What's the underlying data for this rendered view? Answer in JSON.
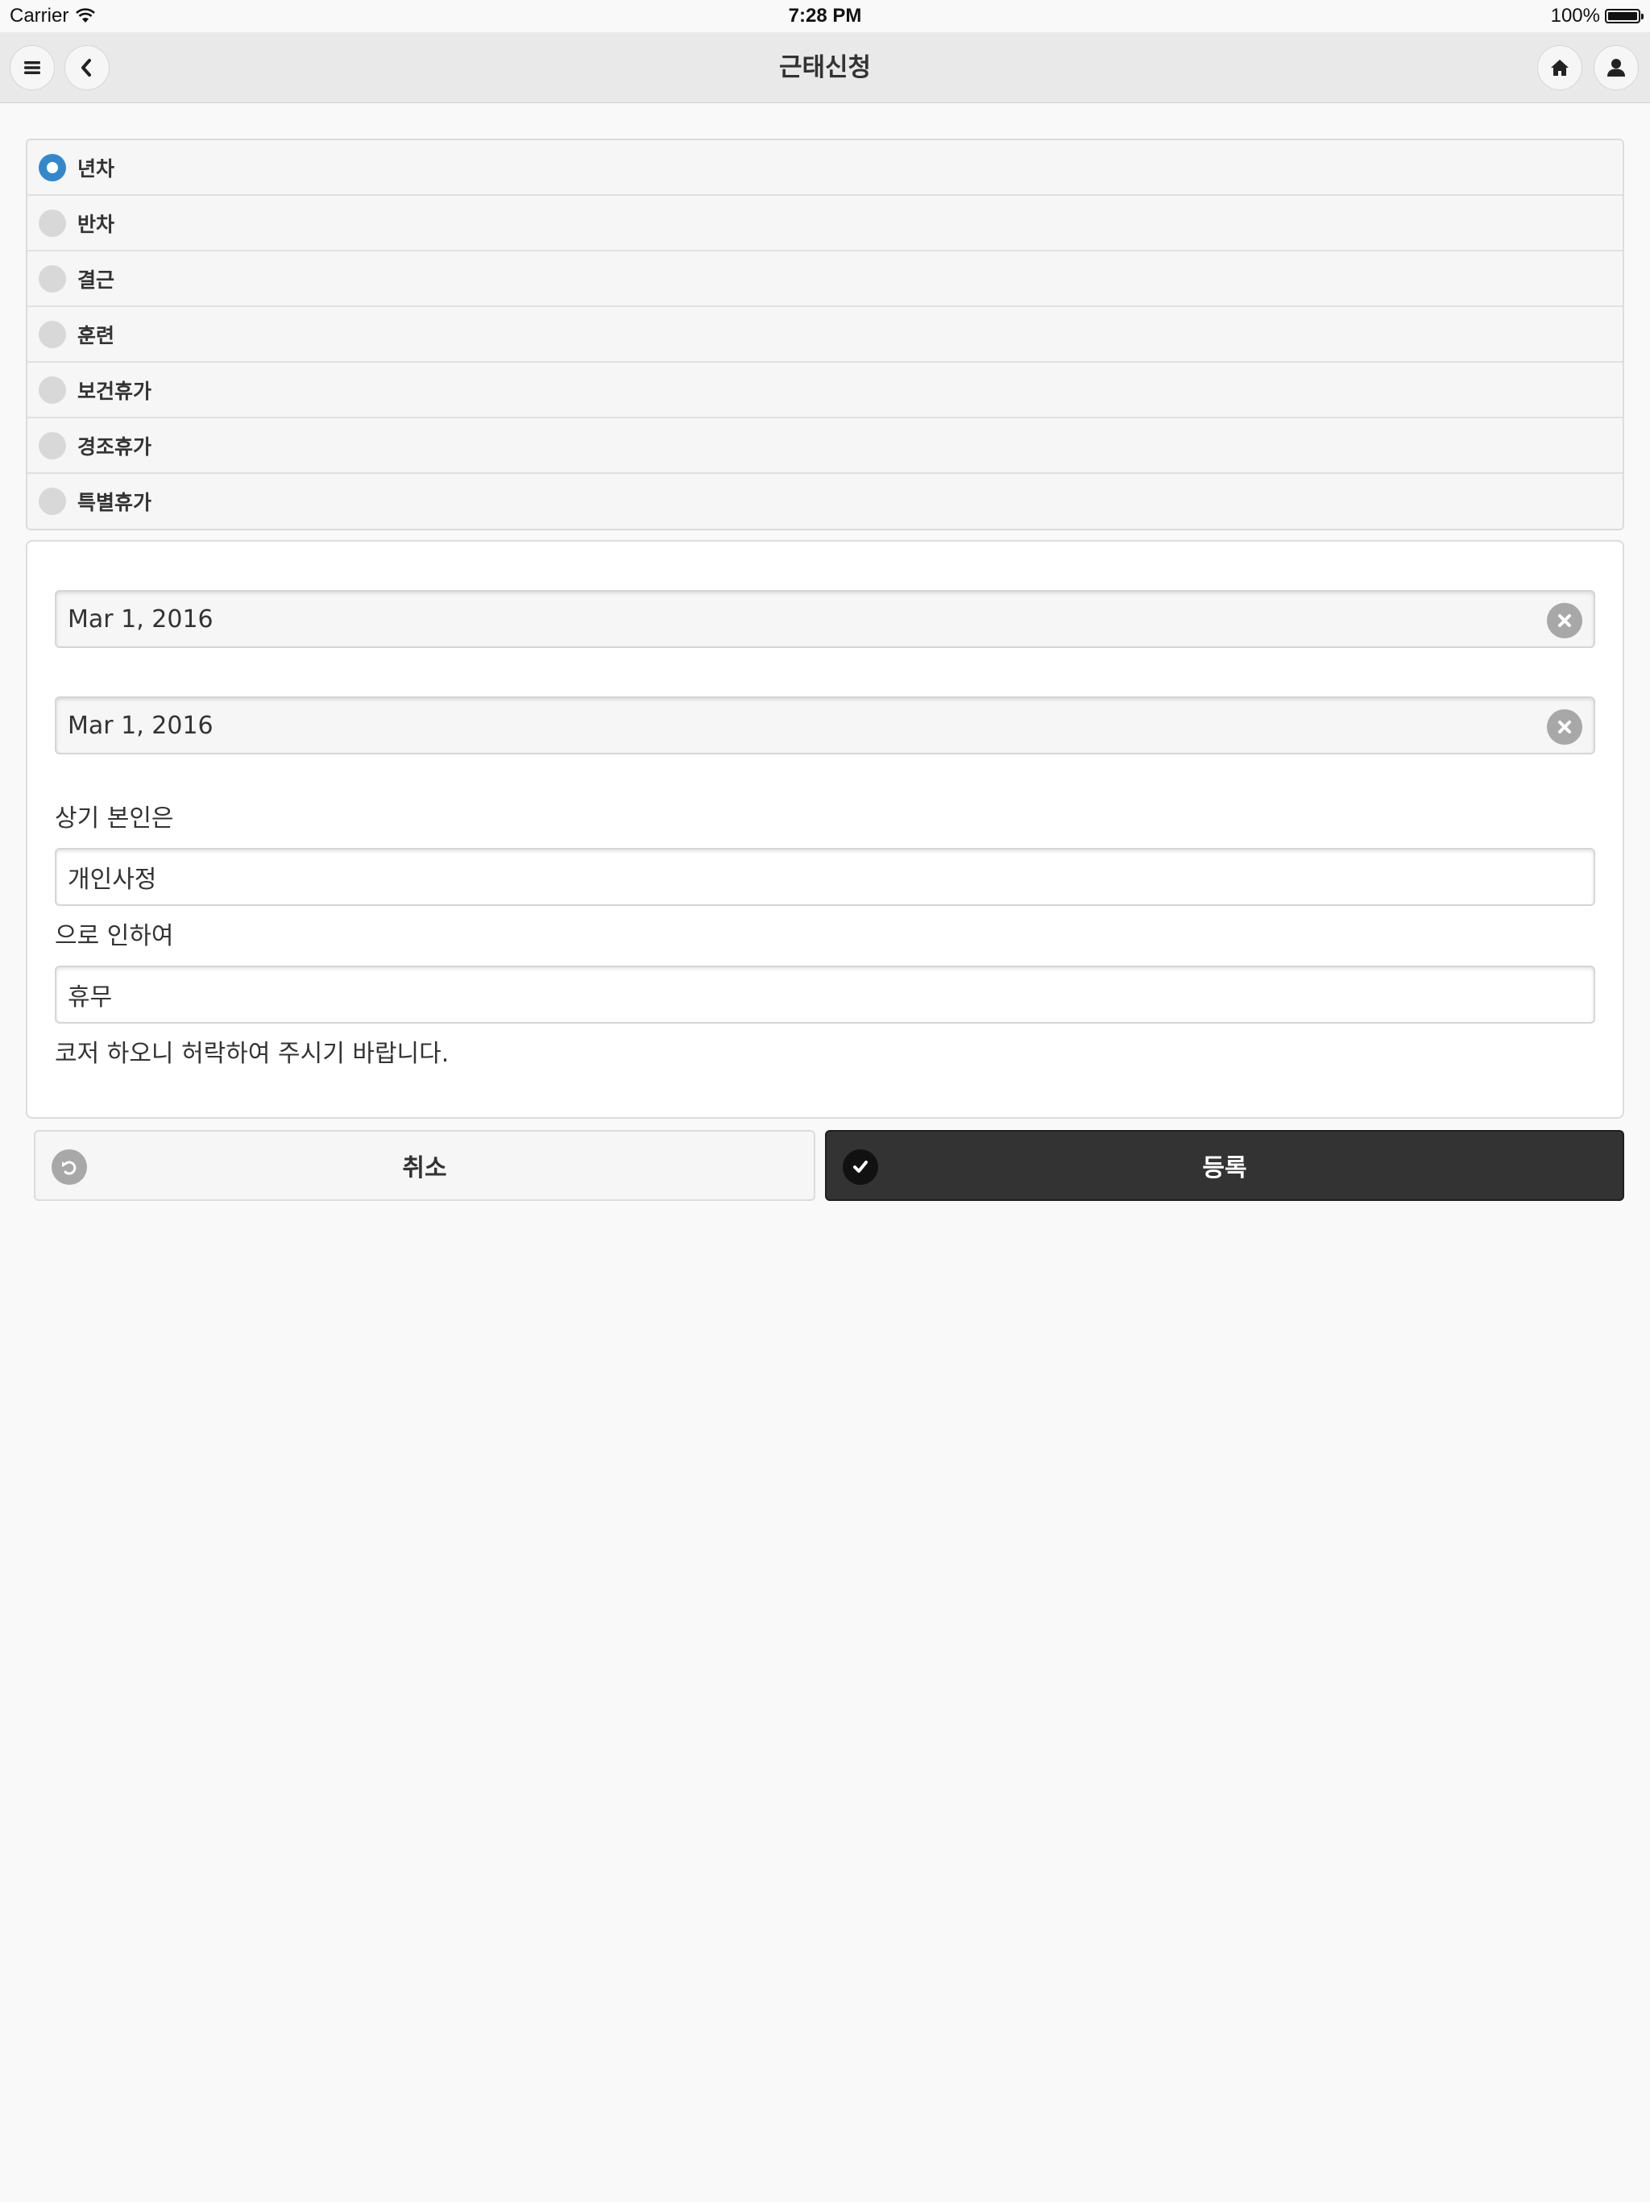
{
  "status_bar": {
    "carrier": "Carrier",
    "time": "7:28 PM",
    "battery": "100%"
  },
  "header": {
    "title": "근태신청",
    "icons": {
      "menu": "menu-icon",
      "back": "back-icon",
      "home": "home-icon",
      "user": "user-icon"
    }
  },
  "leave_type": {
    "selected": "년차",
    "options": [
      {
        "label": "년차",
        "checked": true
      },
      {
        "label": "반차",
        "checked": false
      },
      {
        "label": "결근",
        "checked": false
      },
      {
        "label": "훈련",
        "checked": false
      },
      {
        "label": "보건휴가",
        "checked": false
      },
      {
        "label": "경조휴가",
        "checked": false
      },
      {
        "label": "특별휴가",
        "checked": false
      }
    ]
  },
  "form": {
    "start_date": "Mar 1, 2016",
    "end_date": "Mar 1, 2016",
    "text_before_reason": "상기 본인은",
    "reason_value": "개인사정",
    "text_after_reason": "으로 인하여",
    "type_value": "휴무",
    "closing_text": "코저 하오니 허락하여 주시기 바랍니다."
  },
  "actions": {
    "cancel_label": "취소",
    "submit_label": "등록"
  },
  "colors": {
    "accent": "#3388cc",
    "submit_bg": "#333333",
    "header_bg": "#e9e9e9"
  }
}
